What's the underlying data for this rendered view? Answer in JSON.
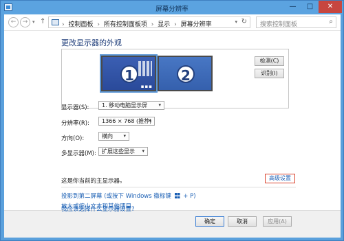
{
  "window": {
    "title": "屏幕分辨率",
    "min_glyph": "—",
    "max_glyph": "□",
    "close_glyph": "✕"
  },
  "nav": {
    "back_glyph": "←",
    "forward_glyph": "→",
    "dropdown_glyph": "▾",
    "up_glyph": "↑",
    "breadcrumb": [
      "控制面板",
      "所有控制面板项",
      "显示",
      "屏幕分辨率"
    ],
    "breadcrumb_sep": "›",
    "address_drop_glyph": "▾",
    "refresh_glyph": "↻",
    "search_placeholder": "搜索控制面板",
    "search_glyph": "⌕"
  },
  "page": {
    "title": "更改显示器的外观",
    "monitor1_number": "1",
    "monitor2_number": "2",
    "monitor_dots": "▪▪▪",
    "detect_label": "检测(C)",
    "identify_label": "识别(I)"
  },
  "settings": {
    "display_label": "显示器(S):",
    "display_value": "1. 移动电脑显示屏",
    "resolution_label": "分辨率(R):",
    "resolution_value": "1366 × 768 (推荐)",
    "orientation_label": "方向(O):",
    "orientation_value": "横向",
    "multi_label": "多显示器(M):",
    "multi_value": "扩展这些显示",
    "caret": "▾"
  },
  "primary": {
    "text": "这是你当前的主显示器。",
    "advanced_label": "高级设置"
  },
  "links": {
    "project_prefix": "投影到第二屏幕 (或按下 Windows 徽标键",
    "project_suffix": "+ P)",
    "enlarge": "放大或缩小文本和其他项目",
    "which": "我应该选择什么显示器设置?"
  },
  "footer": {
    "ok_label": "确定",
    "cancel_label": "取消",
    "apply_label": "应用(A)"
  },
  "colors": {
    "title_bar": "#5ba3e0",
    "close_button": "#c7463f",
    "link": "#1a5fb4",
    "monitor_selected": "#3b5fb3"
  }
}
